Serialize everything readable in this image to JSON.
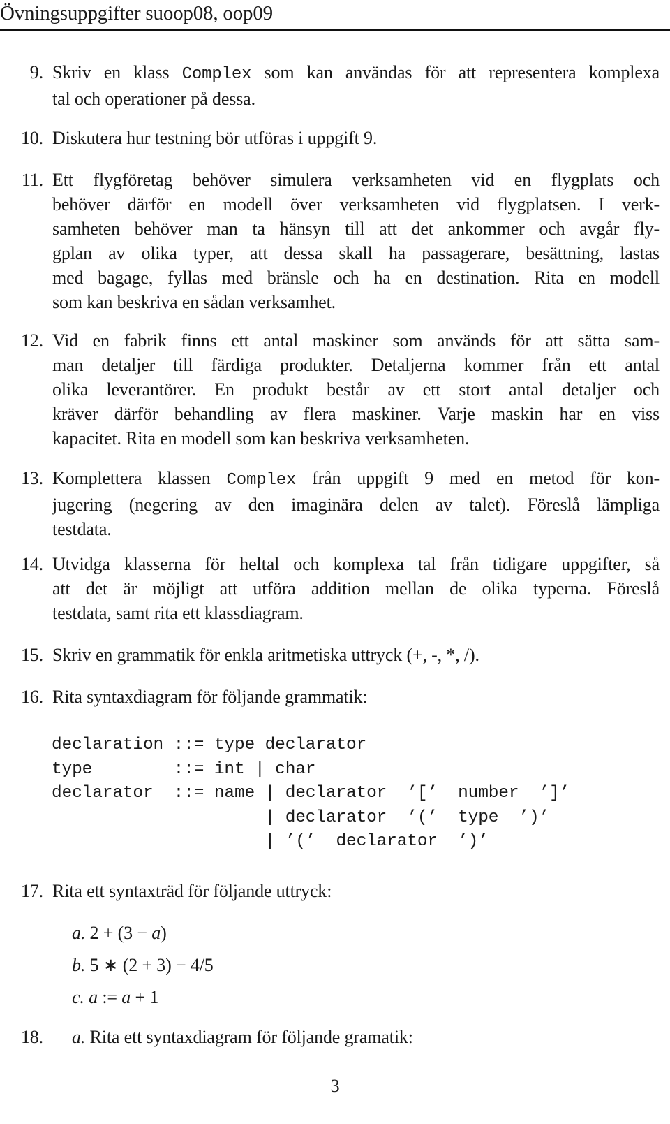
{
  "header": {
    "title": "Övningsuppgifter suoop08, oop09"
  },
  "items": [
    {
      "number": "9.",
      "lines": [
        [
          "Skriv en klass ",
          {
            "code": "Complex"
          },
          " som kan användas för att representera komplexa"
        ],
        [
          "tal och operationer på dessa."
        ]
      ]
    },
    {
      "number": "10.",
      "lines": [
        [
          "Diskutera hur testning bör utföras i uppgift 9."
        ]
      ]
    },
    {
      "number": "11.",
      "lines": [
        [
          "Ett flygföretag behöver simulera verksamheten vid en flygplats och"
        ],
        [
          "behöver därför en modell över verksamheten vid flygplatsen.  I verk-"
        ],
        [
          "samheten behöver man ta hänsyn till att det ankommer och avgår fly-"
        ],
        [
          "gplan av olika typer, att dessa skall ha passagerare, besättning, lastas"
        ],
        [
          "med bagage, fyllas med bränsle och ha en destination. Rita en modell"
        ],
        [
          "som kan beskriva en sådan verksamhet."
        ]
      ]
    },
    {
      "number": "12.",
      "lines": [
        [
          "Vid en fabrik finns ett antal maskiner som används för att sätta sam-"
        ],
        [
          "man detaljer till färdiga produkter.  Detaljerna kommer från ett antal"
        ],
        [
          "olika leverantörer.  En produkt består av ett stort antal detaljer och"
        ],
        [
          "kräver därför behandling av flera maskiner.  Varje maskin har en viss"
        ],
        [
          "kapacitet. Rita en modell som kan beskriva verksamheten."
        ]
      ]
    },
    {
      "number": "13.",
      "lines": [
        [
          "Komplettera klassen ",
          {
            "code": "Complex"
          },
          " från uppgift 9 med en metod för kon-"
        ],
        [
          "jugering (negering av den imaginära delen av talet).  Föreslå lämpliga"
        ],
        [
          "testdata."
        ]
      ]
    },
    {
      "number": "14.",
      "lines": [
        [
          "Utvidga klasserna för heltal och komplexa tal från tidigare uppgifter, så"
        ],
        [
          "att det är möjligt att utföra addition mellan de olika typerna.  Föreslå"
        ],
        [
          "testdata, samt rita ett klassdiagram."
        ]
      ]
    },
    {
      "number": "15.",
      "lines": [
        [
          "Skriv en grammatik för enkla aritmetiska uttryck (+, -, *, /)."
        ]
      ]
    },
    {
      "number": "16.",
      "lines": [
        [
          "Rita syntaxdiagram för följande grammatik:"
        ]
      ]
    },
    {
      "number": "17.",
      "lines": [
        [
          "Rita ett syntaxträd för följande uttryck:"
        ]
      ]
    },
    {
      "number": "18.",
      "lines": [
        [
          {
            "italic": "a."
          },
          " Rita ett syntaxdiagram för följande gramatik:"
        ]
      ]
    }
  ],
  "grammar": [
    "declaration ::= type declarator",
    "type        ::= int | char",
    "declarator  ::= name | declarator  ’[’  number  ’]’",
    "                     | declarator  ’(’  type  ’)’",
    "                     | ’(’  declarator  ’)’"
  ],
  "expressions": [
    {
      "label": "a.",
      "expr": "2 + (3 − a)"
    },
    {
      "label": "b.",
      "expr": "5 ∗ (2 + 3) − 4/5"
    },
    {
      "label": "c.",
      "expr": "a := a + 1"
    }
  ],
  "footer": {
    "page_number": "3"
  }
}
